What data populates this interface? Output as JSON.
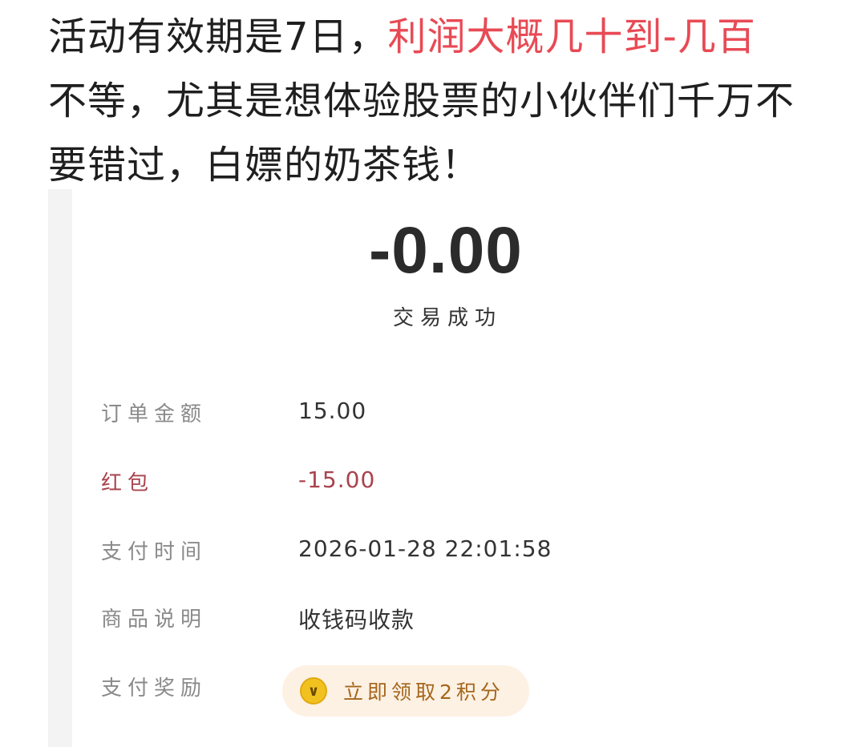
{
  "article": {
    "line1_text": "活动有效期是7日，",
    "line1_highlight": "利润大概几十到-几百",
    "line2": "不等，尤其是想体验股票的小伙伴们千万不",
    "line3": "要错过，白嫖的奶茶钱！"
  },
  "receipt": {
    "amount": "-0.00",
    "status": "交易成功",
    "rows": [
      {
        "label": "订单金额",
        "value": "15.00"
      },
      {
        "label": "红包",
        "value": "-15.00"
      },
      {
        "label": "支付时间",
        "value": "2026-01-28 22:01:58"
      },
      {
        "label": "商品说明",
        "value": "收钱码收款"
      },
      {
        "label": "支付奖励",
        "value": ""
      }
    ],
    "reward_button": "立即领取2积分",
    "coin_icon": "coin-icon"
  },
  "colors": {
    "highlight": "#e84a55",
    "redpacket": "#a8434e",
    "reward_bg": "#fdf1e4",
    "reward_text": "#a5661c"
  }
}
